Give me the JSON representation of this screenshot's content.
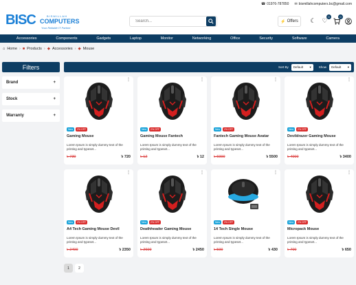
{
  "topbar": {
    "phone": "01976-787850",
    "email": "bismillahcomputers.bc@gmail.com"
  },
  "logo": {
    "big": "BISC",
    "small1": "BISMILLAH",
    "small2": "COMPUTERS",
    "tagline": "Your Reliable IT Partner"
  },
  "search": {
    "placeholder": "Search..."
  },
  "header": {
    "offers_label": "Offers",
    "wishlist_count": "0",
    "cart_count": "0"
  },
  "nav": [
    "Accessories",
    "Components",
    "Gadgets",
    "Laptop",
    "Monitor",
    "Networking",
    "Office",
    "Security",
    "Software",
    "Camera"
  ],
  "breadcrumb": [
    "Home",
    "Products",
    "Accessories",
    "Mouse"
  ],
  "filters": {
    "title": "Filters",
    "facets": [
      "Brand",
      "Stock",
      "Warranty"
    ]
  },
  "toolbar": {
    "sort_label": "Sort By",
    "sort_value": "Default",
    "show_label": "Show",
    "show_value": "Default"
  },
  "products": [
    {
      "name": "Gaming Mouse",
      "tag_new": "New",
      "tag_off": "2% OFF",
      "desc": "Lorem Ipsum is simply dummy text of the printing and typeset...",
      "old_price": "৳ 730",
      "price": "৳ 720",
      "image": "gaming-mouse"
    },
    {
      "name": "Gaming Mouse Fantech",
      "tag_new": "New",
      "tag_off": "2% OFF",
      "desc": "Lorem Ipsum is simply dummy text of the printing and typeset...",
      "old_price": "৳ 12",
      "price": "৳ 12",
      "image": "gaming-mouse"
    },
    {
      "name": "Fantech Gaming Mouse Avatar",
      "tag_new": "New",
      "tag_off": "2% OFF",
      "desc": "Lorem Ipsum is simply dummy text of the printing and typeset...",
      "old_price": "৳ 6000",
      "price": "৳ 5500",
      "image": "gaming-mouse"
    },
    {
      "name": "Devildrazer Gaming Mouse",
      "tag_new": "New",
      "tag_off": "2% OFF",
      "desc": "Lorem Ipsum is simply dummy text of the printing and typeset...",
      "old_price": "৳ 4000",
      "price": "৳ 3400",
      "image": "gaming-mouse"
    },
    {
      "name": "A4 Tech Gaming Mouse Devil",
      "tag_new": "New",
      "tag_off": "2% OFF",
      "desc": "Lorem Ipsum is simply dummy text of the printing and typeset...",
      "old_price": "৳ 2400",
      "price": "৳ 2350",
      "image": "gaming-mouse"
    },
    {
      "name": "Deathheader Gaming Mouse",
      "tag_new": "New",
      "tag_off": "2% OFF",
      "desc": "Lorem Ipsum is simply dummy text of the printing and typeset...",
      "old_price": "৳ 2600",
      "price": "৳ 2450",
      "image": "gaming-mouse"
    },
    {
      "name": "14 Tech Single Mouse",
      "tag_new": "New",
      "tag_off": "2% OFF",
      "desc": "Lorem Ipsum is simply dummy text of the printing and typeset...",
      "old_price": "৳ 500",
      "price": "৳ 430",
      "image": "wireless-mouse"
    },
    {
      "name": "Micropack Mouse",
      "tag_new": "New",
      "tag_off": "2% OFF",
      "desc": "Lorem Ipsum is simply dummy text of the printing and typeset...",
      "old_price": "৳ 700",
      "price": "৳ 650",
      "image": "gaming-mouse"
    }
  ],
  "pagination": {
    "pages": [
      "1",
      "2"
    ],
    "current": "1"
  },
  "colors": {
    "primary": "#0d3d63",
    "accent": "#1a7fd6",
    "sale": "#d92d2d",
    "new": "#1aa3d9"
  }
}
